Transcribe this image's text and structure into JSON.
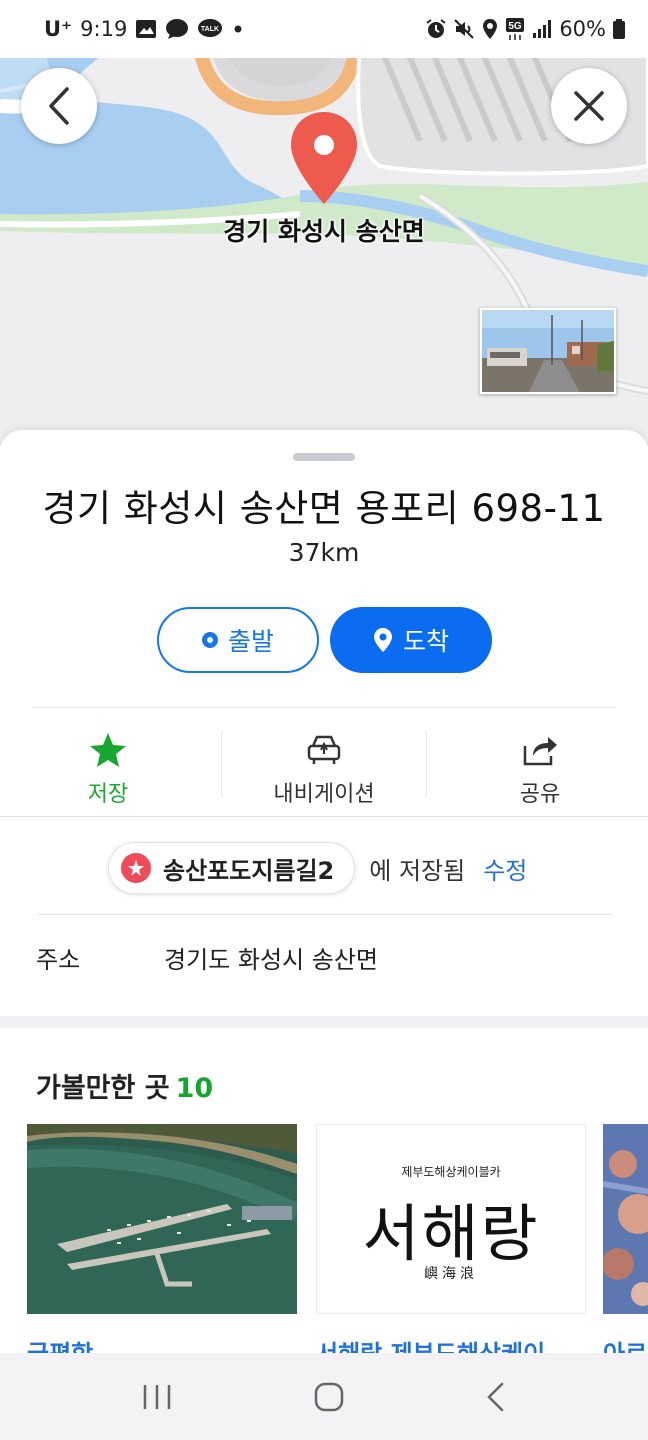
{
  "status_bar": {
    "carrier": "U⁺",
    "time": "9:19",
    "battery": "60%",
    "icons_left": [
      "gallery-icon",
      "message-icon",
      "talk-icon",
      "dot-icon"
    ],
    "icons_right": [
      "alarm-icon",
      "mute-icon",
      "location-icon",
      "5g-icon",
      "signal-icon",
      "battery-icon"
    ],
    "talk_label": "TALK"
  },
  "map": {
    "pin_label": "경기 화성시 송산면",
    "colors": {
      "water": "#a8cef2",
      "green": "#cfe9c9",
      "road": "#ffffff",
      "orange": "#f2b57a",
      "pin": "#ef5a4e"
    }
  },
  "place": {
    "title": "경기 화성시 송산면 용포리 698-11",
    "distance": "37km",
    "start_label": "출발",
    "arrive_label": "도착"
  },
  "actions": [
    {
      "label": "저장",
      "icon": "star-icon"
    },
    {
      "label": "내비게이션",
      "icon": "car-navigation-icon"
    },
    {
      "label": "공유",
      "icon": "share-icon"
    }
  ],
  "saved": {
    "folder": "송산포도지름길2",
    "suffix": "에 저장됨",
    "edit": "수정"
  },
  "address": {
    "label": "주소",
    "value": "경기도 화성시 송산면"
  },
  "recommend": {
    "title": "가볼만한 곳",
    "count": "10",
    "cards": [
      {
        "name": "궁평항"
      },
      {
        "name": "서해랑 제부도해상케이",
        "brand_small": "제부도해상케이블카",
        "brand_big": "서해랑",
        "brand_sub": "嶼海浪"
      },
      {
        "name": "아르"
      }
    ]
  },
  "accent_colors": {
    "primary_blue": "#0a6cf0",
    "save_green": "#19a82f",
    "link_blue": "#1f73d6"
  }
}
